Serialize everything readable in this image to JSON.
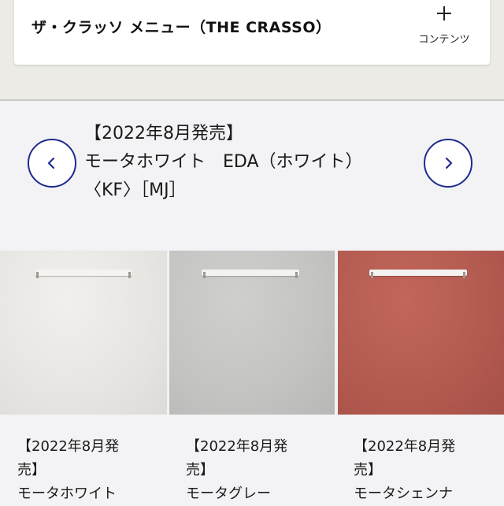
{
  "menu": {
    "title": "ザ・クラッソ メニュー（THE CRASSO）",
    "contents_label": "コンテンツ"
  },
  "carousel": {
    "title_lines": [
      "【2022年8月発売】",
      "モータホワイト　EDA（ホワイト）",
      "〈KF〉［MJ］"
    ],
    "prev_icon": "chevron-left-icon",
    "next_icon": "chevron-right-icon",
    "accent_color": "#1d2b8f"
  },
  "swatches": [
    {
      "color": "#e6e5e1",
      "lines": [
        "【2022年8月発",
        "売】",
        "モータホワイト"
      ]
    },
    {
      "color": "#c3c4c2",
      "lines": [
        "【2022年8月発",
        "売】",
        "モータグレー"
      ]
    },
    {
      "color": "#b35a50",
      "lines": [
        "【2022年8月発",
        "売】",
        "モータシェンナ"
      ]
    }
  ]
}
